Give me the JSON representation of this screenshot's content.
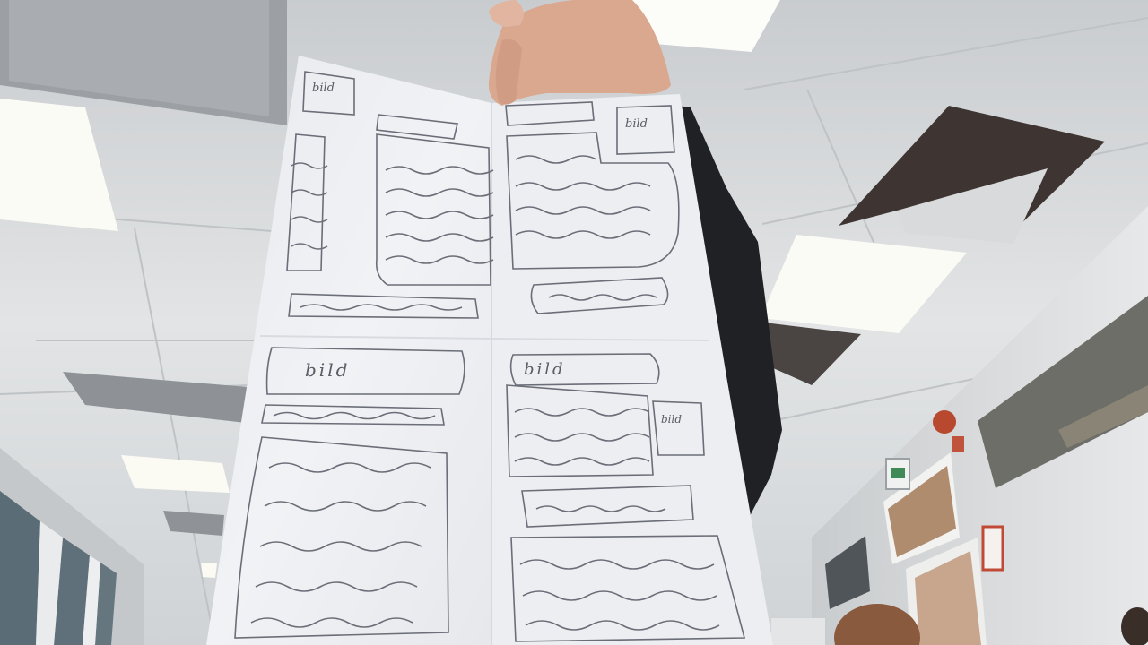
{
  "scene": {
    "subject": "hand-drawn paper wireframe held up in an office",
    "sketch_labels": {
      "top_left_corner": "bild",
      "top_right_corner": "bild",
      "bottom_left_banner": "bild",
      "bottom_right_banner": "bild",
      "bottom_right_side": "bild"
    }
  },
  "colors": {
    "ceiling": "#dfe1e2",
    "paper": "#eef0f2",
    "pencil": "#6b6e78",
    "light": "#fbfbf6",
    "sleeve": "#202226",
    "skin": "#d9a88f"
  }
}
